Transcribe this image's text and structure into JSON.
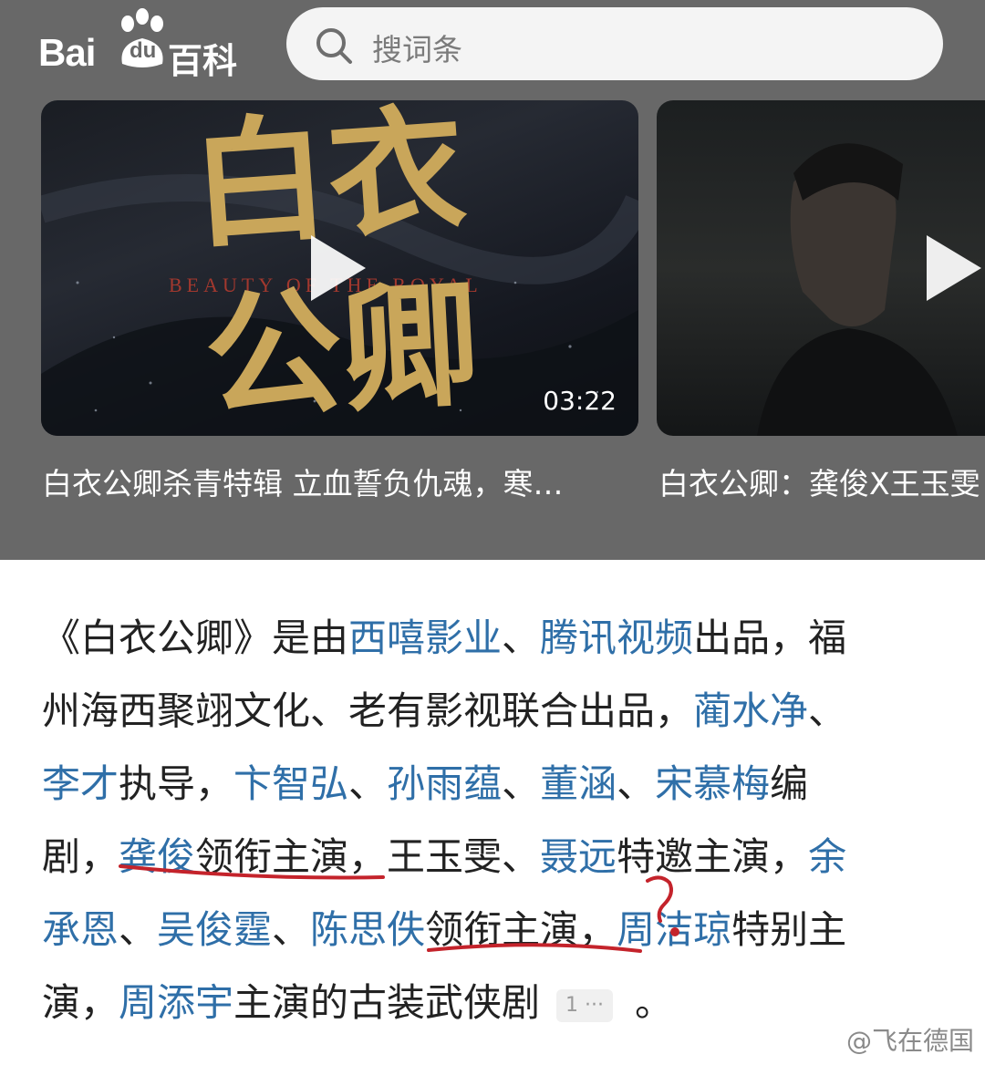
{
  "brand": {
    "logo_bai": "Bai",
    "logo_du": "du",
    "logo_baike": "百科"
  },
  "search": {
    "placeholder": "搜词条"
  },
  "videos": [
    {
      "title_cn_1": "白衣",
      "title_cn_2": "公卿",
      "title_en": "BEAUTY OF THE ROYAL",
      "duration": "03:22",
      "caption": "白衣公卿杀青特辑 立血誓负仇魂，寒…"
    },
    {
      "caption": "白衣公卿：龚俊X王玉雯"
    }
  ],
  "article": {
    "lines": [
      [
        {
          "t": "《白衣公卿》是由"
        },
        {
          "t": "西嘻影业",
          "link": true
        },
        {
          "t": "、"
        },
        {
          "t": "腾讯视频",
          "link": true
        },
        {
          "t": "出品，福"
        }
      ],
      [
        {
          "t": "州海西聚翊文化、老有影视联合出品，"
        },
        {
          "t": "蔺水净",
          "link": true
        },
        {
          "t": "、"
        }
      ],
      [
        {
          "t": "李才",
          "link": true
        },
        {
          "t": "执导，"
        },
        {
          "t": "卞智弘",
          "link": true
        },
        {
          "t": "、"
        },
        {
          "t": "孙雨蕴",
          "link": true
        },
        {
          "t": "、"
        },
        {
          "t": "董涵",
          "link": true
        },
        {
          "t": "、"
        },
        {
          "t": "宋慕梅",
          "link": true
        },
        {
          "t": "编"
        }
      ],
      [
        {
          "t": "剧，"
        },
        {
          "t": "龚俊",
          "link": true
        },
        {
          "t": "领衔主演，王玉雯、"
        },
        {
          "t": "聂远",
          "link": true
        },
        {
          "t": "特邀主演，"
        },
        {
          "t": "余",
          "link": true
        }
      ],
      [
        {
          "t": "承恩",
          "link": true
        },
        {
          "t": "、"
        },
        {
          "t": "吴俊霆",
          "link": true
        },
        {
          "t": "、"
        },
        {
          "t": "陈思佚",
          "link": true
        },
        {
          "t": "领衔主演，"
        },
        {
          "t": "周洁琼",
          "link": true
        },
        {
          "t": "特别主"
        }
      ],
      [
        {
          "t": "演，"
        },
        {
          "t": "周添宇",
          "link": true
        },
        {
          "t": "主演的古装武侠剧"
        }
      ]
    ],
    "reference_badge": "1 ···",
    "end_mark": "。"
  },
  "annotation": {
    "question_mark": "?"
  },
  "watermark": "@飞在德国",
  "colors": {
    "header_bg": "#686868",
    "link": "#2f6fa8",
    "annotation_red": "#c4232b"
  }
}
